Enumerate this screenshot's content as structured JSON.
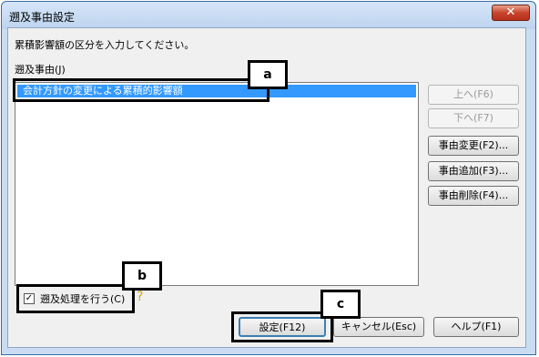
{
  "window": {
    "title": "遡及事由設定",
    "close_glyph": "✕"
  },
  "instruction": "累積影響額の区分を入力してください。",
  "list": {
    "label": "遡及事由(J)",
    "items": [
      "会計方針の変更による累積的影響額"
    ]
  },
  "buttons": {
    "up": "上へ(F6)",
    "down": "下へ(F7)",
    "change": "事由変更(F2)...",
    "add": "事由追加(F3)...",
    "delete": "事由削除(F4)...",
    "ok": "設定(F12)",
    "cancel": "キャンセル(Esc)",
    "help": "ヘルプ(F1)"
  },
  "checkbox": {
    "label": "遡及処理を行う(C)",
    "checked": true,
    "mark": "✓"
  },
  "annotations": [
    "a",
    "b",
    "c"
  ],
  "icons": {
    "help": "question-key-icon"
  }
}
